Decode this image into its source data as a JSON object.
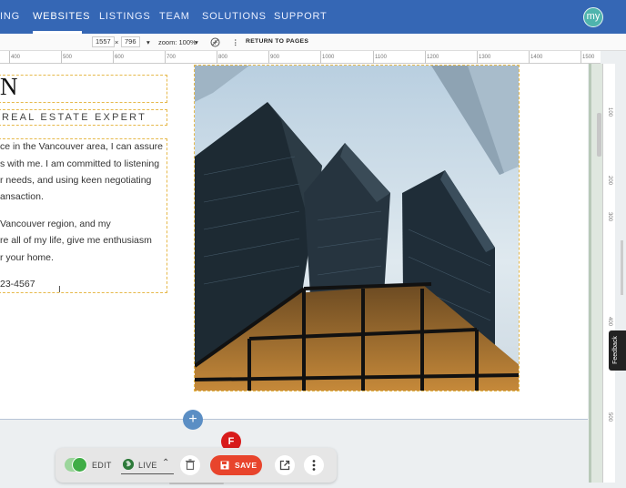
{
  "nav": {
    "tabs": [
      {
        "label": "ING"
      },
      {
        "label": "WEBSITES"
      },
      {
        "label": "LISTINGS"
      },
      {
        "label": "TEAM"
      },
      {
        "label": "SOLUTIONS"
      },
      {
        "label": "SUPPORT"
      }
    ],
    "active_tab": "WEBSITES",
    "avatar_text": "my"
  },
  "toolbar": {
    "width": "1557",
    "times": "×",
    "height": "796",
    "zoom": "zoom: 100%",
    "return_label": "RETURN TO PAGES"
  },
  "ruler": {
    "labels": [
      "400",
      "500",
      "600",
      "700",
      "800",
      "900",
      "1000",
      "1100",
      "1200",
      "1300",
      "1400",
      "1500"
    ],
    "v_labels": [
      "100",
      "200",
      "300",
      "400",
      "500"
    ]
  },
  "content": {
    "heading_fragment": "N",
    "subtitle": "REAL ESTATE EXPERT",
    "para1": [
      "ce in the Vancouver area, I can assure",
      "s with me. I am committed to listening",
      "r needs, and using keen negotiating",
      "ansaction."
    ],
    "para2": [
      "Vancouver region, and my",
      "re all of my life, give me enthusiasm",
      "r your home."
    ],
    "phone_fragment": "23-4567"
  },
  "bottom_bar": {
    "edit_label": "EDIT",
    "live_label": "LIVE",
    "save_label": "SAVE",
    "badge": "F"
  },
  "feedback_label": "Feedback",
  "colors": {
    "nav_bg": "#3567b5",
    "save": "#e8442c",
    "toggle": "#3fad46",
    "badge": "#d81b1b",
    "dashed_outline": "#e6b94b"
  },
  "icons": {
    "avatar": "my-logo-icon",
    "no_grid": "grid-off-icon",
    "more": "more-vertical-icon",
    "globe": "globe-icon",
    "chevron": "chevron-up-icon",
    "delete": "trash-icon",
    "save": "save-disk-icon",
    "open": "open-in-new-icon",
    "add": "plus-icon"
  }
}
